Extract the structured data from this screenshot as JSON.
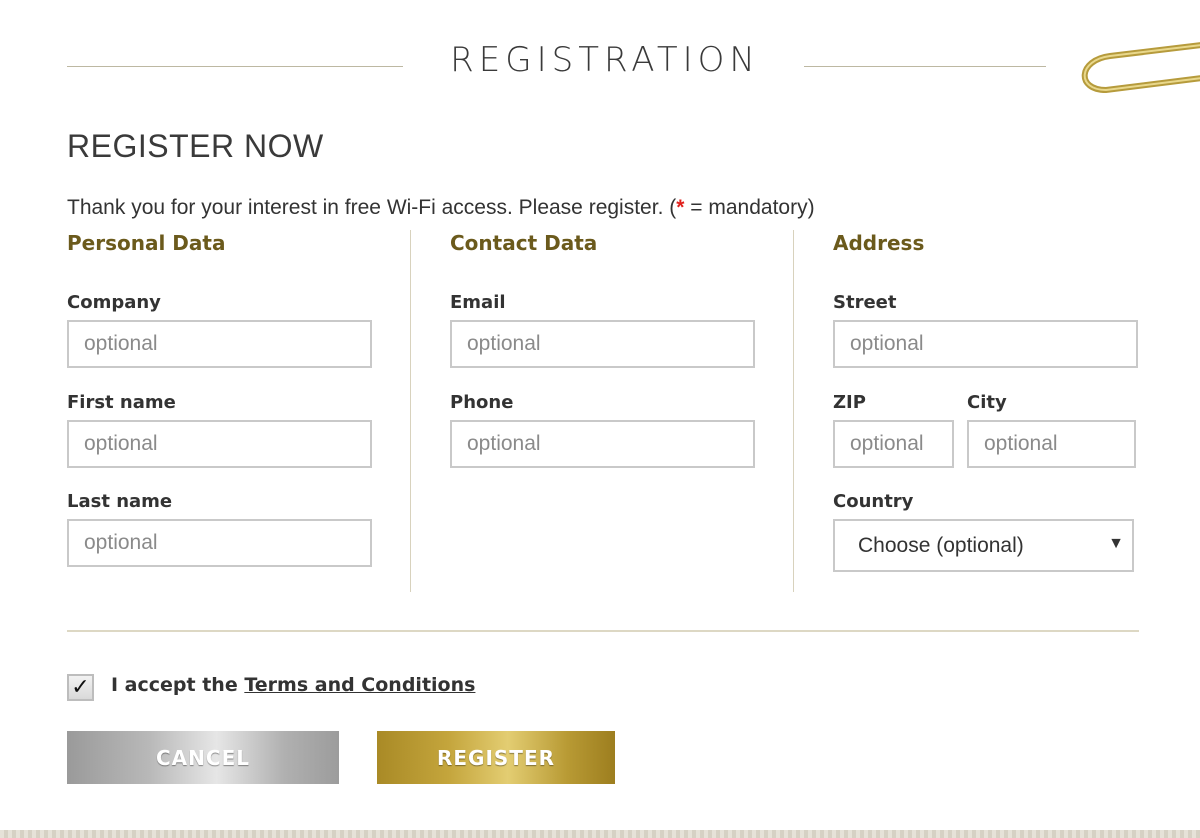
{
  "header": {
    "title": "REGISTRATION"
  },
  "section": {
    "title": "REGISTER NOW"
  },
  "intro": {
    "text_before": "Thank you for your interest in free Wi-Fi access. Please register. (",
    "star": "*",
    "text_after": " = mandatory)"
  },
  "columns": {
    "personal": {
      "title": "Personal Data",
      "company": {
        "label": "Company",
        "placeholder": "optional"
      },
      "first_name": {
        "label": "First name",
        "placeholder": "optional"
      },
      "last_name": {
        "label": "Last name",
        "placeholder": "optional"
      }
    },
    "contact": {
      "title": "Contact Data",
      "email": {
        "label": "Email",
        "placeholder": "optional"
      },
      "phone": {
        "label": "Phone",
        "placeholder": "optional"
      }
    },
    "address": {
      "title": "Address",
      "street": {
        "label": "Street",
        "placeholder": "optional"
      },
      "zip": {
        "label": "ZIP",
        "placeholder": "optional"
      },
      "city": {
        "label": "City",
        "placeholder": "optional"
      },
      "country": {
        "label": "Country",
        "selected": "Choose (optional)"
      }
    }
  },
  "terms": {
    "checked": true,
    "check_glyph": "✓",
    "prefix": "I accept the ",
    "link": "Terms and Conditions"
  },
  "buttons": {
    "cancel": "CANCEL",
    "register": "REGISTER"
  },
  "colors": {
    "accent": "#6b5a1c",
    "gold": "#c4a53c",
    "required": "#e0201c"
  }
}
